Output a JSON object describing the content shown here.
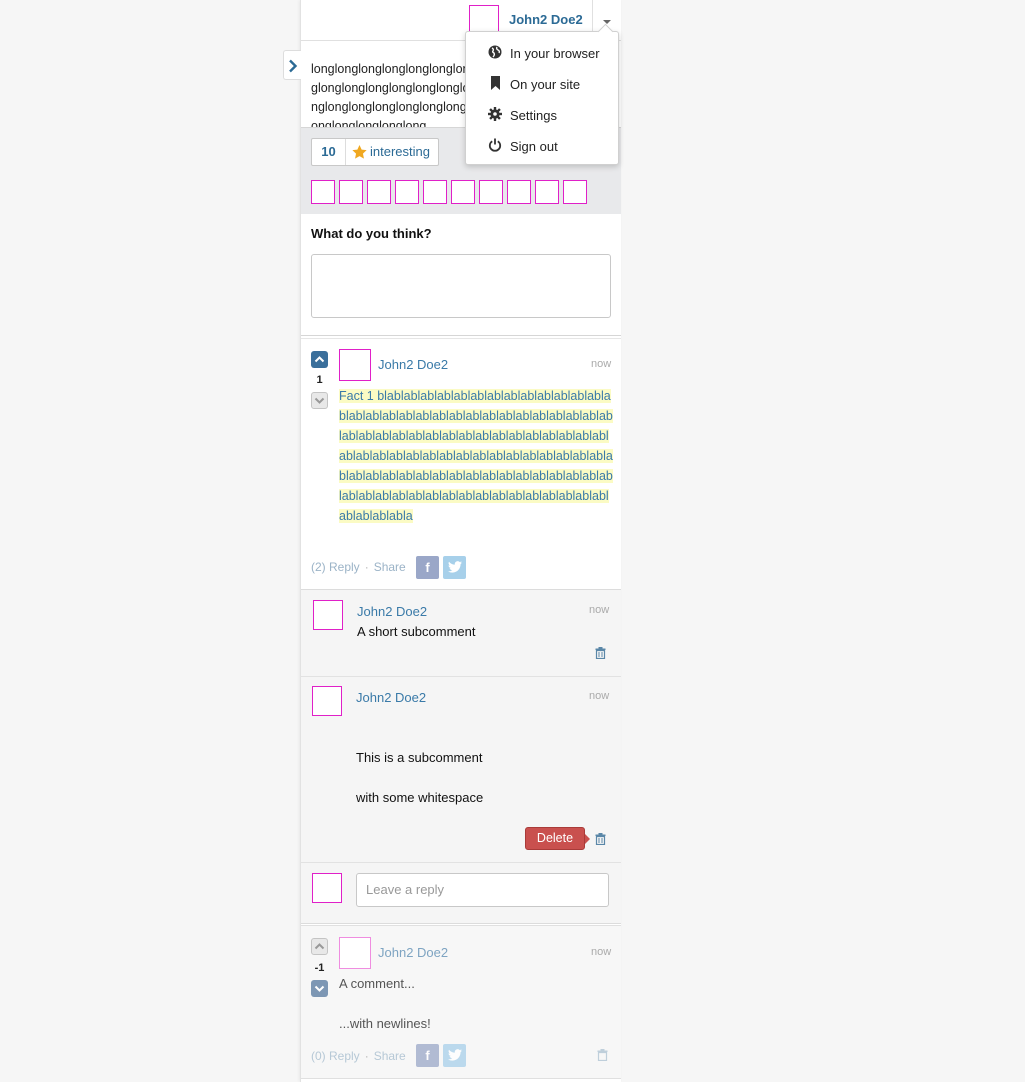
{
  "header": {
    "user_name": "John2 Doe2"
  },
  "menu": {
    "items": [
      {
        "label": "In your browser",
        "icon": "globe-icon"
      },
      {
        "label": "On your site",
        "icon": "bookmark-icon"
      },
      {
        "label": "Settings",
        "icon": "gear-icon"
      },
      {
        "label": "Sign out",
        "icon": "power-icon"
      }
    ]
  },
  "page": {
    "long_text": "longlonglonglonglonglonglonglonglonglonglonglonglonglonglonglonglonglonglonglonglonglonglonglonglong"
  },
  "interest": {
    "count": "10",
    "label": "interesting",
    "star_color": "#f0a820"
  },
  "compose": {
    "title": "What do you think?"
  },
  "comment": {
    "author": "John2 Doe2",
    "time": "now",
    "votes": "1",
    "body": "Fact 1 blablablablablablablablablablablablablablablablablablablablablablablablablablablablablablablablablablablablablablablablablablablablablablablablablablablablablablablablablablablablablablablablablablablablablablablablablablablablablablablablablablablablablablablablablablablablablablablablablablablabla",
    "reply_label": "(2) Reply",
    "share_label": "Share"
  },
  "subcomments": [
    {
      "author": "John2 Doe2",
      "time": "now",
      "text": "A short subcomment"
    },
    {
      "author": "John2 Doe2",
      "time": "now",
      "line1": "This is a subcomment",
      "line2": "with some whitespace",
      "delete_label": "Delete"
    }
  ],
  "reply": {
    "placeholder": "Leave a reply"
  },
  "comment2": {
    "author": "John2 Doe2",
    "time": "now",
    "votes": "-1",
    "line1": "A comment...",
    "line2": "...with newlines!",
    "reply_label": "(0) Reply",
    "share_label": "Share"
  },
  "colors": {
    "accent": "#2b6a95",
    "delete": "#c9504e",
    "highlight": "#fbfbc4",
    "avatar_border": "#e020c8"
  }
}
